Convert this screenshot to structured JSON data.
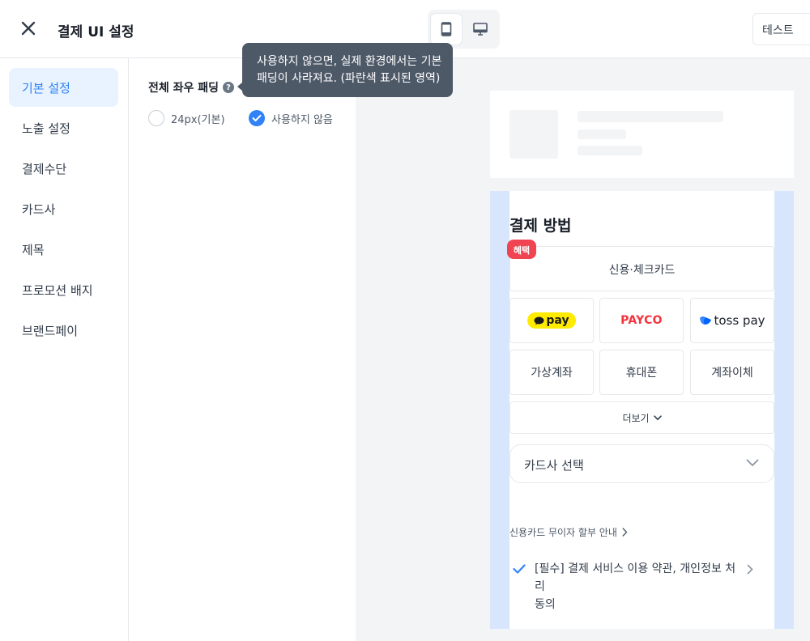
{
  "header": {
    "title": "결제 UI 설정",
    "test_label": "테스트"
  },
  "sidebar": {
    "items": [
      {
        "label": "기본 설정"
      },
      {
        "label": "노출 설정"
      },
      {
        "label": "결제수단"
      },
      {
        "label": "카드사"
      },
      {
        "label": "제목"
      },
      {
        "label": "프로모션 배지"
      },
      {
        "label": "브랜드페이"
      }
    ]
  },
  "settings": {
    "padding_label": "전체 좌우 패딩",
    "option_default": "24px(기본)",
    "option_none": "사용하지 않음",
    "tooltip_line1": "사용하지 않으면, 실제 환경에서는 기본",
    "tooltip_line2": "패딩이 사라져요. (파란색 표시된 영역)"
  },
  "preview": {
    "pay_title": "결제 방법",
    "benefit_badge": "혜택",
    "card_tab": "신용·체크카드",
    "kakao_label": "pay",
    "payco_label": "PAYCO",
    "toss_label": "toss pay",
    "virtual_account": "가상계좌",
    "mobile": "휴대폰",
    "transfer": "계좌이체",
    "more": "더보기",
    "card_select": "카드사 선택",
    "installment": "신용카드 무이자 할부 안내",
    "agree_line1": "[필수] 결제 서비스 이용 약관, 개인정보 처리",
    "agree_line2": "동의"
  },
  "colors": {
    "accent": "#3182f6",
    "active_bg": "#e8f3ff",
    "padding_highlight": "#d8e6fd",
    "badge_red": "#f04452",
    "kakao_yellow": "#ffeb00",
    "payco_red": "#f5333f"
  }
}
